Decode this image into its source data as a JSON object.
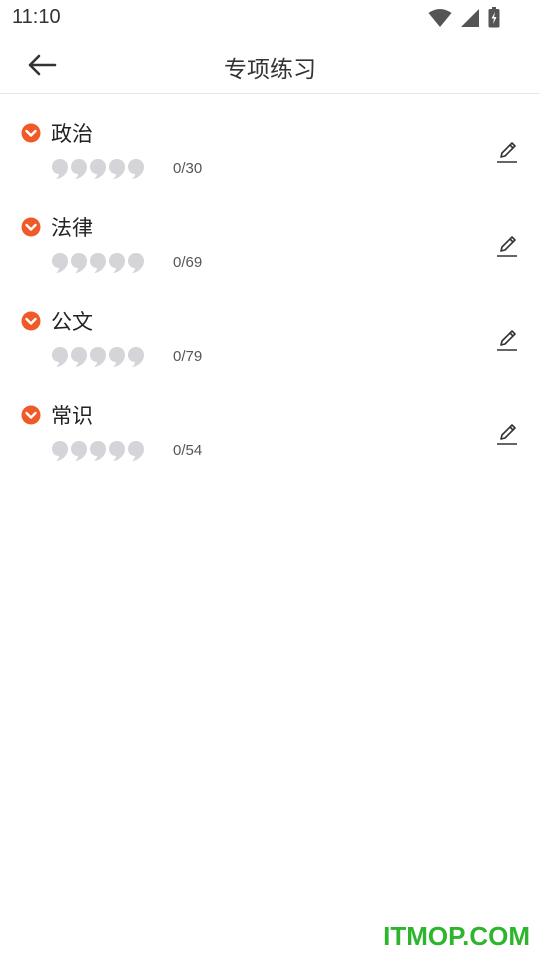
{
  "status_bar": {
    "time": "11:10",
    "icons": [
      "wifi-icon",
      "signal-icon",
      "battery-charging-icon"
    ]
  },
  "header": {
    "title": "专项练习",
    "back_icon": "arrow-left-icon"
  },
  "categories": [
    {
      "name": "政治",
      "progress": "0/30",
      "stars_filled": 0,
      "stars_total": 5
    },
    {
      "name": "法律",
      "progress": "0/69",
      "stars_filled": 0,
      "stars_total": 5
    },
    {
      "name": "公文",
      "progress": "0/79",
      "stars_filled": 0,
      "stars_total": 5
    },
    {
      "name": "常识",
      "progress": "0/54",
      "stars_filled": 0,
      "stars_total": 5
    }
  ],
  "colors": {
    "accent": "#f05a28",
    "star_empty": "#d5d5d9",
    "watermark": "#2db52d"
  },
  "watermark": "ITMOP.COM"
}
